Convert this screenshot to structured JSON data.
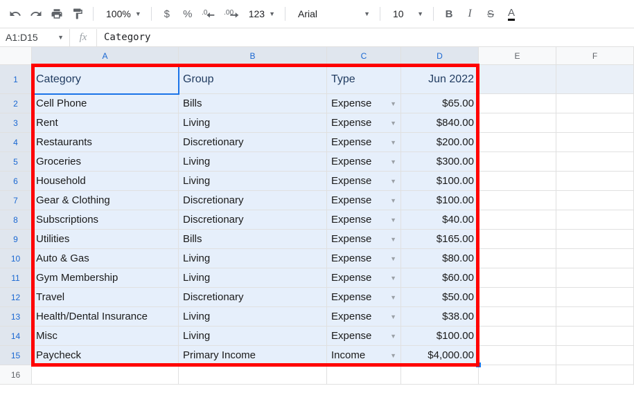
{
  "toolbar": {
    "zoom": "100%",
    "font": "Arial",
    "fontSize": "10"
  },
  "nameBox": "A1:D15",
  "formula": "Category",
  "columns": [
    "A",
    "B",
    "C",
    "D",
    "E",
    "F"
  ],
  "rowCount": 16,
  "headers": {
    "A": "Category",
    "B": "Group",
    "C": "Type",
    "D": "Jun 2022"
  },
  "rows": [
    {
      "A": "Cell Phone",
      "B": "Bills",
      "C": "Expense",
      "D": "$65.00"
    },
    {
      "A": "Rent",
      "B": "Living",
      "C": "Expense",
      "D": "$840.00"
    },
    {
      "A": "Restaurants",
      "B": "Discretionary",
      "C": "Expense",
      "D": "$200.00"
    },
    {
      "A": "Groceries",
      "B": "Living",
      "C": "Expense",
      "D": "$300.00"
    },
    {
      "A": "Household",
      "B": "Living",
      "C": "Expense",
      "D": "$100.00"
    },
    {
      "A": "Gear & Clothing",
      "B": "Discretionary",
      "C": "Expense",
      "D": "$100.00"
    },
    {
      "A": "Subscriptions",
      "B": "Discretionary",
      "C": "Expense",
      "D": "$40.00"
    },
    {
      "A": "Utilities",
      "B": "Bills",
      "C": "Expense",
      "D": "$165.00"
    },
    {
      "A": "Auto & Gas",
      "B": "Living",
      "C": "Expense",
      "D": "$80.00"
    },
    {
      "A": "Gym Membership",
      "B": "Living",
      "C": "Expense",
      "D": "$60.00"
    },
    {
      "A": "Travel",
      "B": "Discretionary",
      "C": "Expense",
      "D": "$50.00"
    },
    {
      "A": "Health/Dental Insurance",
      "B": "Living",
      "C": "Expense",
      "D": "$38.00"
    },
    {
      "A": "Misc",
      "B": "Living",
      "C": "Expense",
      "D": "$100.00"
    },
    {
      "A": "Paycheck",
      "B": "Primary Income",
      "C": "Income",
      "D": "$4,000.00"
    }
  ],
  "chart_data": {
    "type": "table",
    "title": "",
    "columns": [
      "Category",
      "Group",
      "Type",
      "Jun 2022"
    ],
    "data": [
      [
        "Cell Phone",
        "Bills",
        "Expense",
        65.0
      ],
      [
        "Rent",
        "Living",
        "Expense",
        840.0
      ],
      [
        "Restaurants",
        "Discretionary",
        "Expense",
        200.0
      ],
      [
        "Groceries",
        "Living",
        "Expense",
        300.0
      ],
      [
        "Household",
        "Living",
        "Expense",
        100.0
      ],
      [
        "Gear & Clothing",
        "Discretionary",
        "Expense",
        100.0
      ],
      [
        "Subscriptions",
        "Discretionary",
        "Expense",
        40.0
      ],
      [
        "Utilities",
        "Bills",
        "Expense",
        165.0
      ],
      [
        "Auto & Gas",
        "Living",
        "Expense",
        80.0
      ],
      [
        "Gym Membership",
        "Living",
        "Expense",
        60.0
      ],
      [
        "Travel",
        "Discretionary",
        "Expense",
        50.0
      ],
      [
        "Health/Dental Insurance",
        "Living",
        "Expense",
        38.0
      ],
      [
        "Misc",
        "Living",
        "Expense",
        100.0
      ],
      [
        "Paycheck",
        "Primary Income",
        "Income",
        4000.0
      ]
    ]
  }
}
